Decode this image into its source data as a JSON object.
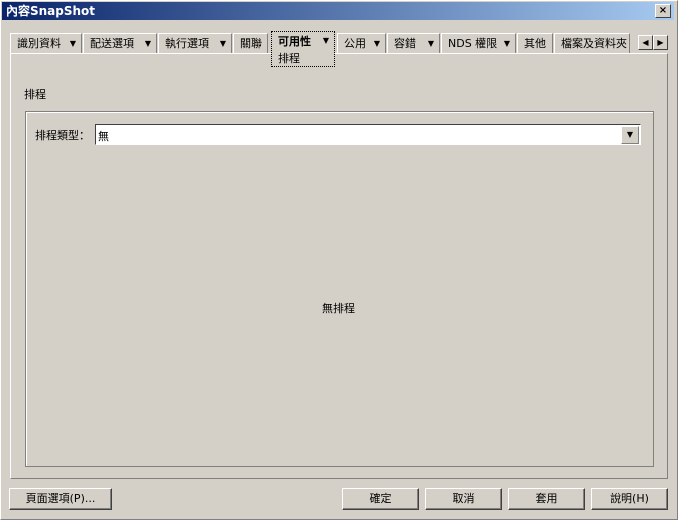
{
  "window": {
    "title": "內容SnapShot",
    "close_symbol": "×"
  },
  "tabs": [
    {
      "label": "識別資料",
      "arrow": "▼"
    },
    {
      "label": "配送選項",
      "arrow": "▼"
    },
    {
      "label": "執行選項",
      "arrow": "▼"
    },
    {
      "label": "關聯"
    },
    {
      "label": "可用性",
      "arrow": "▼",
      "subtab": "排程",
      "active": true
    },
    {
      "label": "公用",
      "arrow": "▼"
    },
    {
      "label": "容錯",
      "arrow": "▼"
    },
    {
      "label": "NDS 權限",
      "arrow": "▼"
    },
    {
      "label": "其他"
    },
    {
      "label": "檔案及資料夾"
    }
  ],
  "tab_scroll": {
    "left_symbol": "◀",
    "right_symbol": "▶"
  },
  "section_title": "排程",
  "schedule_type": {
    "label": "排程類型：",
    "value": "無",
    "dropdown_symbol": "▼"
  },
  "empty_message": "無排程",
  "buttons": {
    "page_options": "頁面選項(P)...",
    "ok": "確定",
    "cancel": "取消",
    "apply": "套用",
    "help": "說明(H)"
  }
}
